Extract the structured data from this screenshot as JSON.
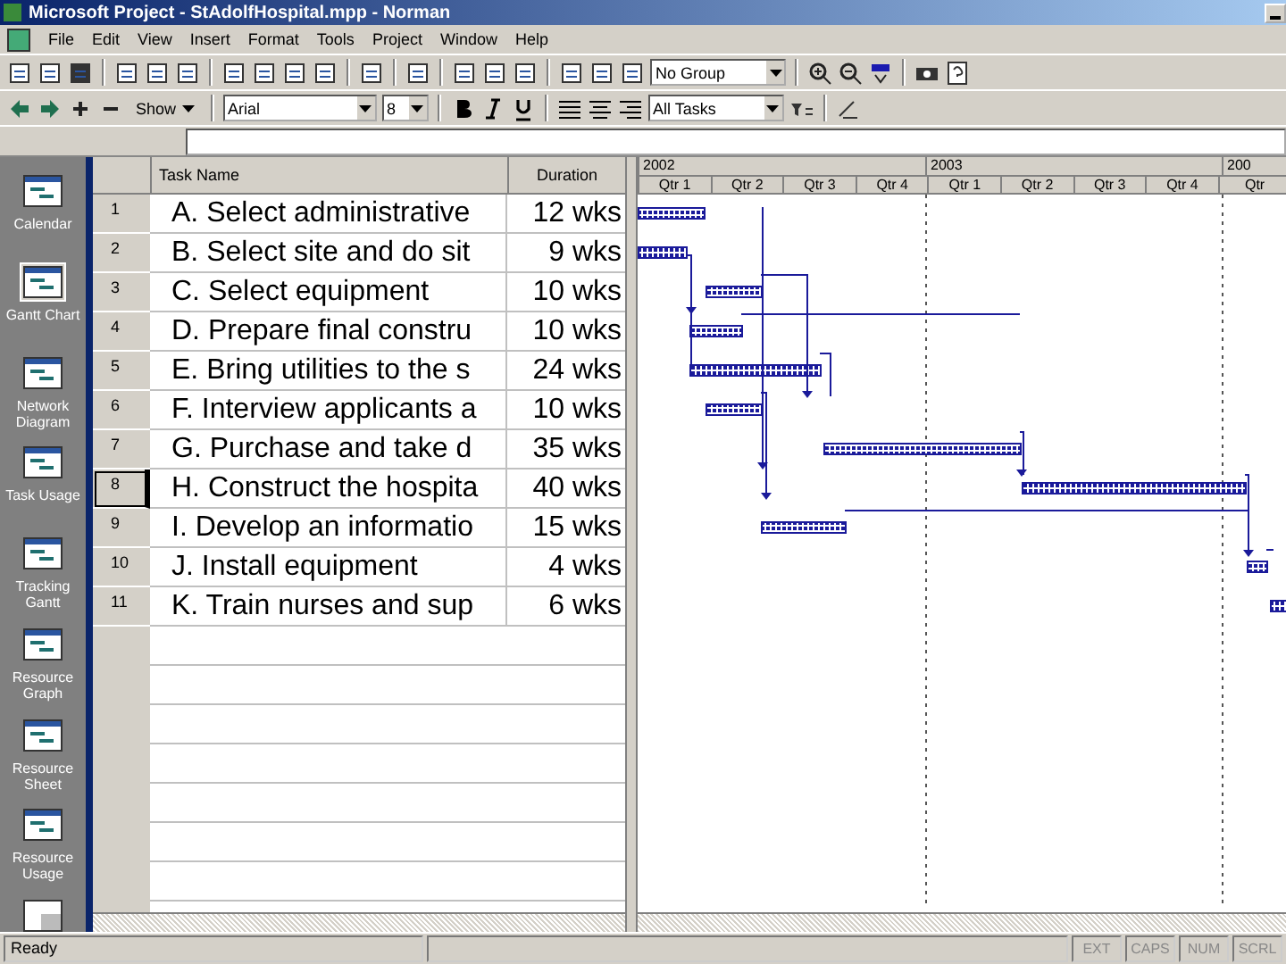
{
  "window": {
    "title": "Microsoft Project - StAdolfHospital.mpp - Norman"
  },
  "menu": [
    "File",
    "Edit",
    "View",
    "Insert",
    "Format",
    "Tools",
    "Project",
    "Window",
    "Help"
  ],
  "toolbar": {
    "group": "No Group",
    "show": "Show",
    "font": "Arial",
    "size": "8",
    "filter": "All Tasks"
  },
  "view_bar": [
    {
      "label": "Calendar",
      "selected": false
    },
    {
      "label": "Gantt Chart",
      "selected": true
    },
    {
      "label": "Network Diagram",
      "selected": false
    },
    {
      "label": "Task Usage",
      "selected": false
    },
    {
      "label": "Tracking Gantt",
      "selected": false
    },
    {
      "label": "Resource Graph",
      "selected": false
    },
    {
      "label": "Resource Sheet",
      "selected": false
    },
    {
      "label": "Resource Usage",
      "selected": false
    }
  ],
  "table": {
    "columns": [
      "Task Name",
      "Duration"
    ],
    "rows": [
      {
        "id": "1",
        "name": "A. Select administrative",
        "duration": "12 wks",
        "selected": false
      },
      {
        "id": "2",
        "name": "B. Select site and do sit",
        "duration": "9 wks",
        "selected": false
      },
      {
        "id": "3",
        "name": "C. Select equipment",
        "duration": "10 wks",
        "selected": false
      },
      {
        "id": "4",
        "name": "D. Prepare final constru",
        "duration": "10 wks",
        "selected": false
      },
      {
        "id": "5",
        "name": "E. Bring utilities to the s",
        "duration": "24 wks",
        "selected": false
      },
      {
        "id": "6",
        "name": "F. Interview applicants a",
        "duration": "10 wks",
        "selected": false
      },
      {
        "id": "7",
        "name": "G. Purchase and take d",
        "duration": "35 wks",
        "selected": false
      },
      {
        "id": "8",
        "name": "H. Construct the hospita",
        "duration": "40 wks",
        "selected": true
      },
      {
        "id": "9",
        "name": "I. Develop an informatio",
        "duration": "15 wks",
        "selected": false
      },
      {
        "id": "10",
        "name": "J. Install equipment",
        "duration": "4 wks",
        "selected": false
      },
      {
        "id": "11",
        "name": "K. Train nurses and sup",
        "duration": "6 wks",
        "selected": false
      }
    ]
  },
  "timescale": {
    "years": [
      "2002",
      "2003",
      "200"
    ],
    "quarters": [
      "Qtr 1",
      "Qtr 2",
      "Qtr 3",
      "Qtr 4",
      "Qtr 1",
      "Qtr 2",
      "Qtr 3",
      "Qtr 4",
      "Qtr"
    ]
  },
  "status_bar": {
    "text": "Ready",
    "indicators": [
      "EXT",
      "CAPS",
      "NUM",
      "SCRL"
    ]
  }
}
